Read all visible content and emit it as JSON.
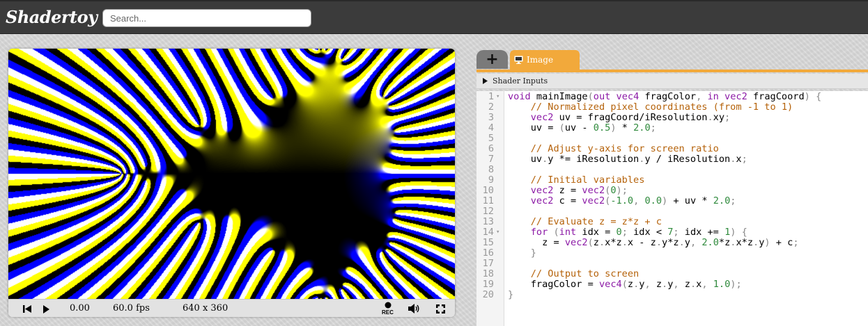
{
  "app": {
    "logo": "Shadertoy"
  },
  "search": {
    "placeholder": "Search..."
  },
  "player": {
    "time": "0.00",
    "fps": "60.0 fps",
    "resolution": "640 x 360",
    "rec_label": "REC",
    "icons": [
      "rewind-icon",
      "play-icon",
      "record-icon",
      "volume-icon",
      "fullscreen-icon"
    ]
  },
  "editor": {
    "add_tab_label": "+",
    "active_tab": "Image",
    "shader_inputs_label": "Shader Inputs",
    "accent_color": "#f2a93b",
    "lines": [
      {
        "n": "1",
        "fold": "▾",
        "t": [
          [
            "void",
            "k"
          ],
          [
            " mainImage",
            "b"
          ],
          [
            "(",
            "o"
          ],
          [
            "out vec4",
            "k"
          ],
          [
            " fragColor",
            "b"
          ],
          [
            ", ",
            "o"
          ],
          [
            "in vec2",
            "k"
          ],
          [
            " fragCoord",
            "b"
          ],
          [
            ") {",
            "o"
          ]
        ]
      },
      {
        "n": "2",
        "fold": "",
        "t": [
          [
            "    // Normalized pixel coordinates (from -1 to 1)",
            "c"
          ]
        ]
      },
      {
        "n": "3",
        "fold": "",
        "t": [
          [
            "    vec2",
            "k"
          ],
          [
            " uv = fragCoord/iResolution",
            "b"
          ],
          [
            ".",
            "o"
          ],
          [
            "xy",
            "b"
          ],
          [
            ";",
            "o"
          ]
        ]
      },
      {
        "n": "4",
        "fold": "",
        "t": [
          [
            "    uv = ",
            "b"
          ],
          [
            "(",
            "o"
          ],
          [
            "uv - ",
            "b"
          ],
          [
            "0.5",
            "n"
          ],
          [
            ")",
            "o"
          ],
          [
            " * ",
            "b"
          ],
          [
            "2.0",
            "n"
          ],
          [
            ";",
            "o"
          ]
        ]
      },
      {
        "n": "5",
        "fold": "",
        "t": [
          [
            "",
            "b"
          ]
        ]
      },
      {
        "n": "6",
        "fold": "",
        "t": [
          [
            "    // Adjust y-axis for screen ratio",
            "c"
          ]
        ]
      },
      {
        "n": "7",
        "fold": "",
        "t": [
          [
            "    uv",
            "b"
          ],
          [
            ".",
            "o"
          ],
          [
            "y *= iResolution",
            "b"
          ],
          [
            ".",
            "o"
          ],
          [
            "y / iResolution",
            "b"
          ],
          [
            ".",
            "o"
          ],
          [
            "x",
            "b"
          ],
          [
            ";",
            "o"
          ]
        ]
      },
      {
        "n": "8",
        "fold": "",
        "t": [
          [
            "",
            "b"
          ]
        ]
      },
      {
        "n": "9",
        "fold": "",
        "t": [
          [
            "    // Initial variables",
            "c"
          ]
        ]
      },
      {
        "n": "10",
        "fold": "",
        "t": [
          [
            "    vec2",
            "k"
          ],
          [
            " z = ",
            "b"
          ],
          [
            "vec2",
            "k"
          ],
          [
            "(",
            "o"
          ],
          [
            "0",
            "n"
          ],
          [
            ");",
            "o"
          ]
        ]
      },
      {
        "n": "11",
        "fold": "",
        "t": [
          [
            "    vec2",
            "k"
          ],
          [
            " c = ",
            "b"
          ],
          [
            "vec2",
            "k"
          ],
          [
            "(",
            "o"
          ],
          [
            "-1.0",
            "n"
          ],
          [
            ", ",
            "o"
          ],
          [
            "0.0",
            "n"
          ],
          [
            ")",
            "o"
          ],
          [
            " + uv * ",
            "b"
          ],
          [
            "2.0",
            "n"
          ],
          [
            ";",
            "o"
          ]
        ]
      },
      {
        "n": "12",
        "fold": "",
        "t": [
          [
            "",
            "b"
          ]
        ]
      },
      {
        "n": "13",
        "fold": "",
        "t": [
          [
            "    // Evaluate z = z*z + c",
            "c"
          ]
        ]
      },
      {
        "n": "14",
        "fold": "▾",
        "t": [
          [
            "    for",
            "k"
          ],
          [
            " (",
            "o"
          ],
          [
            "int",
            "k"
          ],
          [
            " idx = ",
            "b"
          ],
          [
            "0",
            "n"
          ],
          [
            "; ",
            "o"
          ],
          [
            "idx < ",
            "b"
          ],
          [
            "7",
            "n"
          ],
          [
            "; ",
            "o"
          ],
          [
            "idx += ",
            "b"
          ],
          [
            "1",
            "n"
          ],
          [
            ") {",
            "o"
          ]
        ]
      },
      {
        "n": "15",
        "fold": "",
        "t": [
          [
            "      z = ",
            "b"
          ],
          [
            "vec2",
            "k"
          ],
          [
            "(",
            "o"
          ],
          [
            "z",
            "b"
          ],
          [
            ".",
            "o"
          ],
          [
            "x",
            "b"
          ],
          [
            "*",
            "b"
          ],
          [
            "z",
            "b"
          ],
          [
            ".",
            "o"
          ],
          [
            "x - z",
            "b"
          ],
          [
            ".",
            "o"
          ],
          [
            "y",
            "b"
          ],
          [
            "*",
            "b"
          ],
          [
            "z",
            "b"
          ],
          [
            ".",
            "o"
          ],
          [
            "y",
            "b"
          ],
          [
            ", ",
            "o"
          ],
          [
            "2.0",
            "n"
          ],
          [
            "*",
            "b"
          ],
          [
            "z",
            "b"
          ],
          [
            ".",
            "o"
          ],
          [
            "x",
            "b"
          ],
          [
            "*",
            "b"
          ],
          [
            "z",
            "b"
          ],
          [
            ".",
            "o"
          ],
          [
            "y",
            "b"
          ],
          [
            ")",
            "o"
          ],
          [
            " + c",
            "b"
          ],
          [
            ";",
            "o"
          ]
        ]
      },
      {
        "n": "16",
        "fold": "",
        "t": [
          [
            "    }",
            "o"
          ]
        ]
      },
      {
        "n": "17",
        "fold": "",
        "t": [
          [
            "",
            "b"
          ]
        ]
      },
      {
        "n": "18",
        "fold": "",
        "t": [
          [
            "    // Output to screen",
            "c"
          ]
        ]
      },
      {
        "n": "19",
        "fold": "",
        "t": [
          [
            "    fragColor = ",
            "b"
          ],
          [
            "vec4",
            "k"
          ],
          [
            "(",
            "o"
          ],
          [
            "z",
            "b"
          ],
          [
            ".",
            "o"
          ],
          [
            "y",
            "b"
          ],
          [
            ", ",
            "o"
          ],
          [
            "z",
            "b"
          ],
          [
            ".",
            "o"
          ],
          [
            "y",
            "b"
          ],
          [
            ", ",
            "o"
          ],
          [
            "z",
            "b"
          ],
          [
            ".",
            "o"
          ],
          [
            "x",
            "b"
          ],
          [
            ", ",
            "o"
          ],
          [
            "1.0",
            "n"
          ],
          [
            ");",
            "o"
          ]
        ]
      },
      {
        "n": "20",
        "fold": "",
        "t": [
          [
            "}",
            "o"
          ]
        ]
      }
    ]
  }
}
